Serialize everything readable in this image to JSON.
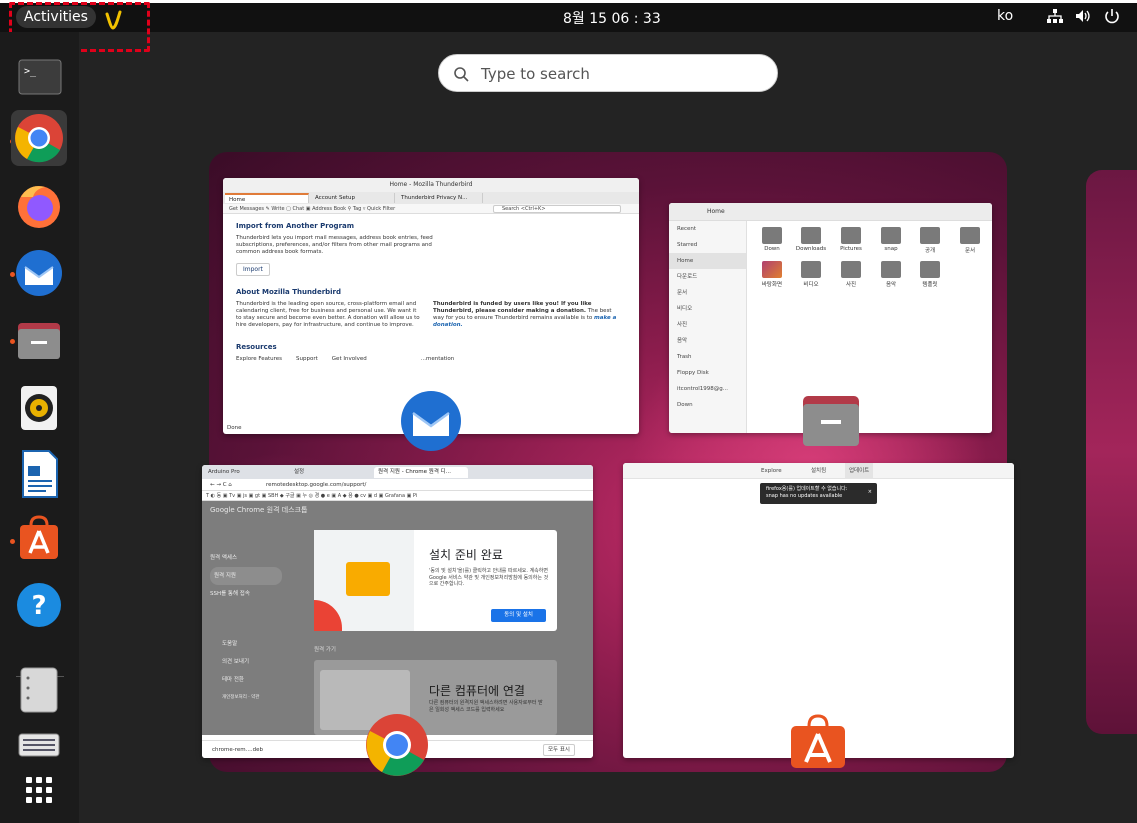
{
  "topbar": {
    "activities_label": "Activities",
    "clock": "8월 15  06 : 33",
    "language": "ko"
  },
  "search": {
    "placeholder": "Type to search"
  },
  "dock": {
    "items": [
      {
        "name": "terminal-icon",
        "running": false
      },
      {
        "name": "chrome-icon",
        "running": true
      },
      {
        "name": "firefox-icon",
        "running": false
      },
      {
        "name": "thunderbird-icon",
        "running": true
      },
      {
        "name": "files-icon",
        "running": true
      },
      {
        "name": "rhythmbox-icon",
        "running": false
      },
      {
        "name": "libreoffice-writer-icon",
        "running": false
      },
      {
        "name": "ubuntu-software-icon",
        "running": true
      },
      {
        "name": "help-icon",
        "running": false
      },
      {
        "name": "disk-icon",
        "running": false
      },
      {
        "name": "drive-icon",
        "running": false
      },
      {
        "name": "show-apps-icon",
        "running": false
      }
    ]
  },
  "thunderbird": {
    "title": "Home - Mozilla Thunderbird",
    "tabs": [
      "Home",
      "Account Setup",
      "Thunderbird Privacy N..."
    ],
    "toolbar": "Get Messages  ✎ Write  ▢ Chat  ▣ Address Book  ⚲ Tag  ▿ Quick Filter",
    "search_placeholder": "Search <Ctrl+K>",
    "import_heading": "Import from Another Program",
    "import_text": "Thunderbird lets you import mail messages, address book entries, feed subscriptions, preferences, and/or filters from other mail programs and common address book formats.",
    "import_button": "Import",
    "about_heading": "About Mozilla Thunderbird",
    "about_text": "Thunderbird is the leading open source, cross-platform email and calendaring client, free for business and personal use. We want it to stay secure and become even better. A donation will allow us to hire developers, pay for infrastructure, and continue to improve.",
    "donate_bold": "Thunderbird is funded by users like you! If you like Thunderbird, please consider making a donation.",
    "donate_rest": " The best way for you to ensure Thunderbird remains available is to ",
    "donate_link": "make a donation.",
    "resources_heading": "Resources",
    "resources": [
      "Explore Features",
      "Support",
      "Get Involved",
      "...mentation"
    ],
    "status": "Done"
  },
  "files": {
    "path": "Home",
    "sidebar": [
      "Recent",
      "Starred",
      "Home",
      "다운로드",
      "문서",
      "비디오",
      "사진",
      "음악",
      "Trash",
      "Floppy Disk",
      "itcontrol1998@g...",
      "Down"
    ],
    "folders": [
      "Down",
      "Downloads",
      "Pictures",
      "snap",
      "공개",
      "문서",
      "바탕화면",
      "비디오",
      "사진",
      "음악",
      "템플릿"
    ]
  },
  "chrome": {
    "tabs": [
      "Arduino Pro",
      "설정",
      "원격 지원 - Chrome 원격 디..."
    ],
    "url": "remotedesktop.google.com/support/",
    "bookmarks": "T  ◐ 동  ▣ Tv  ▣ js  ▣ gt  ▣ SBH  ◆ 구글  ▣ 누  ◎ 경  ● e  ▣ A  ◆ 용  ● cv  ▣ d  ▣ Grafana  ▣ Pi",
    "header": "Google Chrome 원격 데스크톱",
    "sidebar": [
      "원격 액세스",
      "원격 지원",
      "SSH를 통해 접속"
    ],
    "sidebar_bottom": [
      "도움말",
      "의견 보내기",
      "테마 전환",
      "개인정보처리 · 약관"
    ],
    "dialog_title": "설치 준비 완료",
    "dialog_text": "'동의 및 설치'을(를) 클릭하고 안내를 따르세요. 계속하면 Google 서비스 약관 및 개인정보처리방침에 동의하는 것으로 간주합니다.",
    "dialog_button": "동의 및 설치",
    "section_label": "원격 가기",
    "connect_title": "다른 컴퓨터에 연결",
    "connect_text": "다른 컴퓨터의 원격지원 액세스하려면 사용자로부터 받은 일회성 액세스 코드를 입력하세요",
    "download_file": "chrome-rem....deb",
    "show_all": "모두 표시"
  },
  "software": {
    "tabs": [
      "Explore",
      "설치됨",
      "업데이트"
    ],
    "toast_line1": "firefox용(를) 업데이트할 수 없습니다:",
    "toast_line2": "snap has no updates available"
  }
}
